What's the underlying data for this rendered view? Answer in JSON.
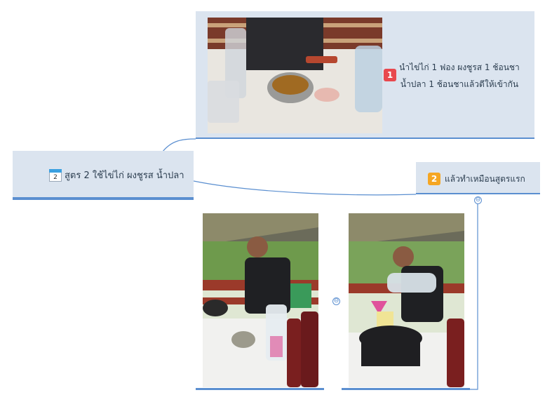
{
  "main_node": {
    "icon": "calendar-icon",
    "icon_number": "2",
    "label": "สูตร 2 ใช้ไข่ไก่ ผงชูรส น้ำปลา"
  },
  "top_node": {
    "badge": "1",
    "text_line1": "นำไข่ไก่ 1 ฟอง ผงชูรส 1 ช้อนชา",
    "text_line2": "น้ำปลา 1 ช้อนชาแล้วตีให้เข้ากัน"
  },
  "right_node": {
    "badge": "2",
    "text": "แล้วทำเหมือนสูตรแรก"
  },
  "collapse_symbol": "⊖",
  "colors": {
    "node_bg": "#dbe4ef",
    "connector": "#5b8fd0",
    "badge1": "#e8484e",
    "badge2": "#f5a623"
  }
}
